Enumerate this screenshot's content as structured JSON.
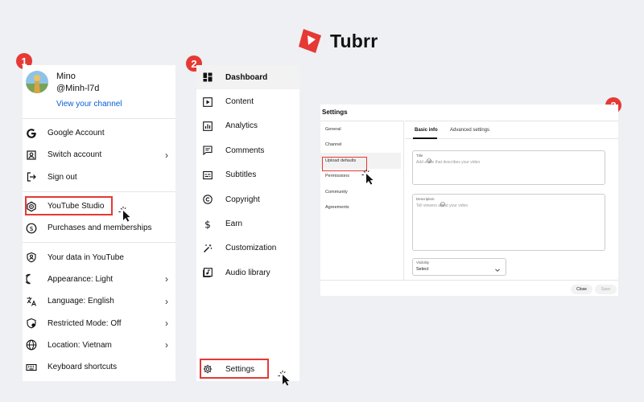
{
  "brand": {
    "name": "Tubrr",
    "color": "#e53935"
  },
  "steps": [
    "1",
    "2",
    "3"
  ],
  "account_menu": {
    "profile": {
      "name": "Mino",
      "handle": "@Minh-l7d",
      "view_channel": "View your channel"
    },
    "groups": [
      [
        {
          "label": "Google Account",
          "icon": "google-icon",
          "chevron": false
        },
        {
          "label": "Switch account",
          "icon": "switch-account-icon",
          "chevron": true
        },
        {
          "label": "Sign out",
          "icon": "sign-out-icon",
          "chevron": false
        }
      ],
      [
        {
          "label": "YouTube Studio",
          "icon": "youtube-studio-icon",
          "chevron": false,
          "highlighted": true
        },
        {
          "label": "Purchases and memberships",
          "icon": "dollar-icon",
          "chevron": false
        }
      ],
      [
        {
          "label": "Your data in YouTube",
          "icon": "shield-person-icon",
          "chevron": false
        },
        {
          "label": "Appearance: Light",
          "icon": "moon-icon",
          "chevron": true
        },
        {
          "label": "Language: English",
          "icon": "translate-icon",
          "chevron": true
        },
        {
          "label": "Restricted Mode: Off",
          "icon": "restricted-shield-icon",
          "chevron": true
        },
        {
          "label": "Location: Vietnam",
          "icon": "globe-icon",
          "chevron": true
        },
        {
          "label": "Keyboard shortcuts",
          "icon": "keyboard-icon",
          "chevron": false
        }
      ]
    ]
  },
  "studio_nav": {
    "items": [
      {
        "label": "Dashboard",
        "icon": "dashboard-icon",
        "active": true
      },
      {
        "label": "Content",
        "icon": "content-icon"
      },
      {
        "label": "Analytics",
        "icon": "analytics-icon"
      },
      {
        "label": "Comments",
        "icon": "comments-icon"
      },
      {
        "label": "Subtitles",
        "icon": "subtitles-icon"
      },
      {
        "label": "Copyright",
        "icon": "copyright-icon"
      },
      {
        "label": "Earn",
        "icon": "dollar-icon"
      },
      {
        "label": "Customization",
        "icon": "magic-wand-icon"
      },
      {
        "label": "Audio library",
        "icon": "audio-library-icon"
      }
    ],
    "settings_label": "Settings"
  },
  "settings_dialog": {
    "title": "Settings",
    "sidebar": [
      "General",
      "Channel",
      "Upload defaults",
      "Permissions",
      "Community",
      "Agreements"
    ],
    "active_sidebar": "Upload defaults",
    "tabs": [
      "Basic info",
      "Advanced settings"
    ],
    "active_tab": "Basic info",
    "title_field": {
      "label": "Title",
      "placeholder": "Add a title that describes your video"
    },
    "description_field": {
      "label": "Description",
      "placeholder": "Tell viewers about your video"
    },
    "visibility": {
      "label": "Visibility",
      "value": "Select"
    },
    "buttons": {
      "close": "Close",
      "save": "Save"
    }
  }
}
